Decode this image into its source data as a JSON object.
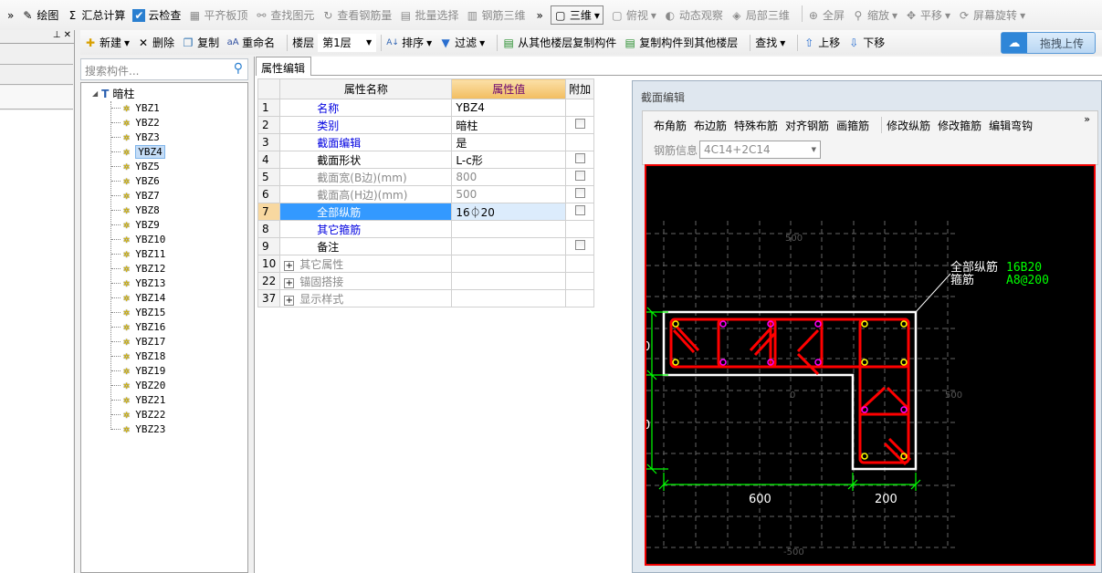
{
  "toolbar1": {
    "items": [
      {
        "label": "绘图",
        "icon": "draw-icon",
        "enabled": true
      },
      {
        "label": "汇总计算",
        "icon": "sigma-icon",
        "enabled": true
      },
      {
        "label": "云检查",
        "icon": "cloud-check-icon",
        "enabled": true
      },
      {
        "label": "平齐板顶",
        "icon": "align-slab-icon",
        "enabled": false
      },
      {
        "label": "查找图元",
        "icon": "binoculars-icon",
        "enabled": false
      },
      {
        "label": "查看钢筋量",
        "icon": "view-rebar-icon",
        "enabled": false
      },
      {
        "label": "批量选择",
        "icon": "batch-select-icon",
        "enabled": false
      },
      {
        "label": "钢筋三维",
        "icon": "rebar-3d-icon",
        "enabled": false
      }
    ],
    "view_items": [
      {
        "label": "三维",
        "icon": "cube-icon"
      },
      {
        "label": "俯视",
        "icon": "top-view-icon"
      },
      {
        "label": "动态观察",
        "icon": "orbit-icon"
      },
      {
        "label": "局部三维",
        "icon": "local-3d-icon"
      },
      {
        "label": "全屏",
        "icon": "fullscreen-icon"
      },
      {
        "label": "缩放",
        "icon": "zoom-icon"
      },
      {
        "label": "平移",
        "icon": "pan-icon"
      },
      {
        "label": "屏幕旋转",
        "icon": "rotate-screen-icon"
      }
    ]
  },
  "toolbar2": {
    "new": "新建",
    "delete": "删除",
    "copy": "复制",
    "rename": "重命名",
    "floor_label": "楼层",
    "floor_value": "第1层",
    "sort": "排序",
    "filter": "过滤",
    "copy_from": "从其他楼层复制构件",
    "copy_to": "复制构件到其他楼层",
    "find": "查找",
    "up": "上移",
    "down": "下移",
    "upload": "拖拽上传"
  },
  "tree": {
    "search_placeholder": "搜索构件...",
    "root": "暗柱",
    "selected": "YBZ4",
    "items": [
      "YBZ1",
      "YBZ2",
      "YBZ3",
      "YBZ4",
      "YBZ5",
      "YBZ6",
      "YBZ7",
      "YBZ8",
      "YBZ9",
      "YBZ10",
      "YBZ11",
      "YBZ12",
      "YBZ13",
      "YBZ14",
      "YBZ15",
      "YBZ16",
      "YBZ17",
      "YBZ18",
      "YBZ19",
      "YBZ20",
      "YBZ21",
      "YBZ22",
      "YBZ23"
    ]
  },
  "props": {
    "tab": "属性编辑",
    "headers": [
      "属性名称",
      "属性值",
      "附加"
    ],
    "rows": [
      {
        "no": "1",
        "name": "名称",
        "value": "YBZ4",
        "style": "blue",
        "check": false
      },
      {
        "no": "2",
        "name": "类别",
        "value": "暗柱",
        "style": "blue",
        "check": true
      },
      {
        "no": "3",
        "name": "截面编辑",
        "value": "是",
        "style": "blue",
        "check": false
      },
      {
        "no": "4",
        "name": "截面形状",
        "value": "L-c形",
        "style": "",
        "check": true
      },
      {
        "no": "5",
        "name": "截面宽(B边)(mm)",
        "value": "800",
        "style": "gray",
        "check": true
      },
      {
        "no": "6",
        "name": "截面高(H边)(mm)",
        "value": "500",
        "style": "gray",
        "check": true
      },
      {
        "no": "7",
        "name": "全部纵筋",
        "value": "16⏀20",
        "style": "sel",
        "check": true
      },
      {
        "no": "8",
        "name": "其它箍筋",
        "value": "",
        "style": "blue",
        "check": false
      },
      {
        "no": "9",
        "name": "备注",
        "value": "",
        "style": "",
        "check": true
      },
      {
        "no": "10",
        "name": "其它属性",
        "value": "",
        "style": "group",
        "check": false
      },
      {
        "no": "22",
        "name": "锚固搭接",
        "value": "",
        "style": "group",
        "check": false
      },
      {
        "no": "37",
        "name": "显示样式",
        "value": "",
        "style": "group",
        "check": false
      }
    ]
  },
  "section": {
    "title": "截面编辑",
    "tools": [
      "布角筋",
      "布边筋",
      "特殊布筋",
      "对齐钢筋",
      "画箍筋",
      "修改纵筋",
      "修改箍筋",
      "编辑弯钩"
    ],
    "rebar_info_label": "钢筋信息",
    "rebar_info_value": "4C14+2C14",
    "canvas": {
      "label_long": "全部纵筋",
      "value_long": "16B20",
      "label_stirrup": "箍筋",
      "value_stirrup": "A8@200",
      "dim_b1": "600",
      "dim_b2": "200",
      "grid_labels": [
        "500",
        "0",
        "500",
        "-500"
      ],
      "left_dims": [
        "0",
        "0"
      ]
    }
  }
}
